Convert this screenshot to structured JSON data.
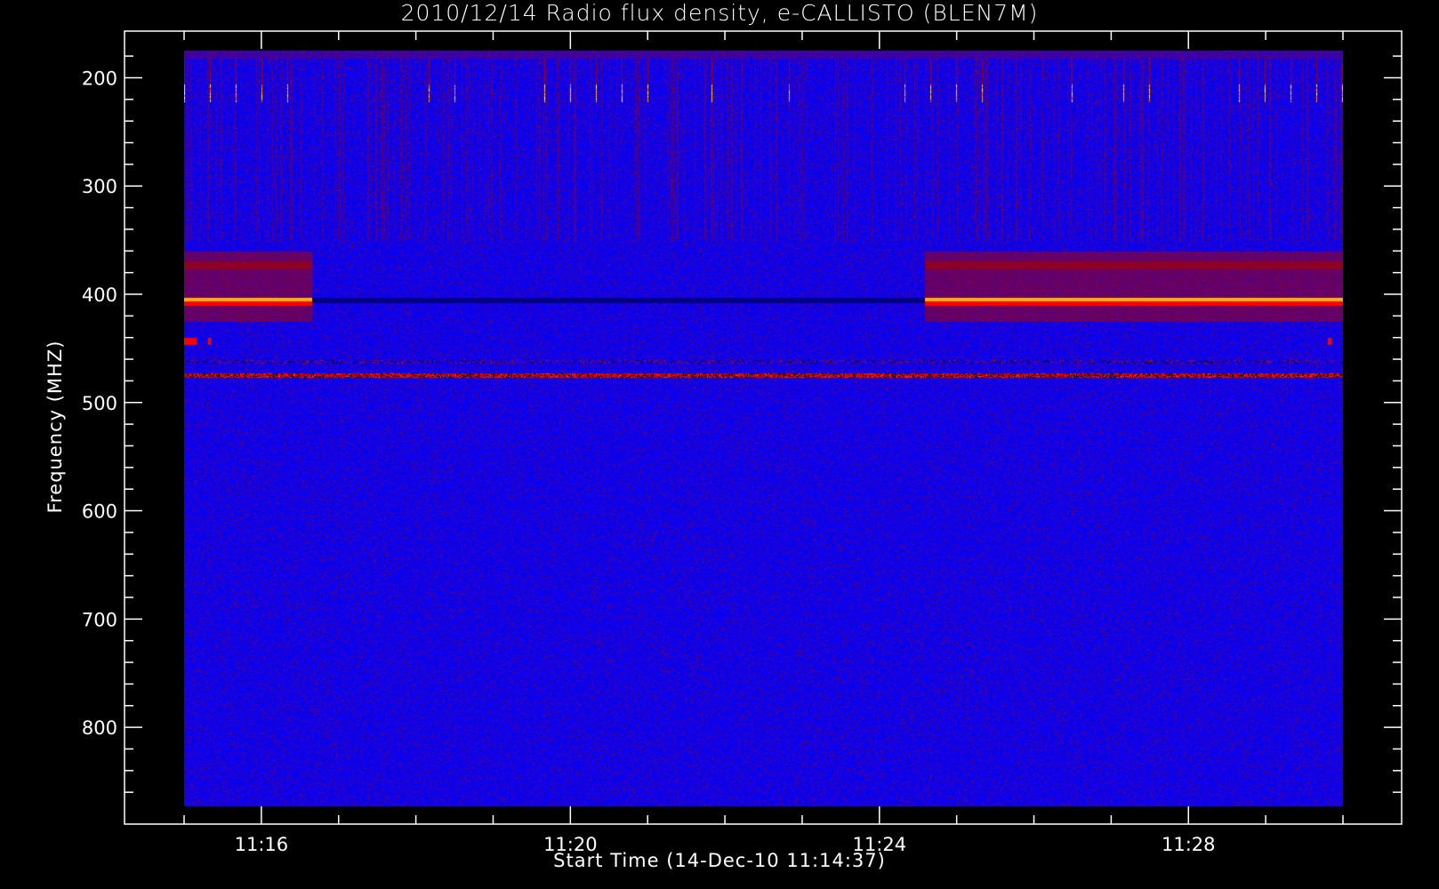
{
  "chart_data": {
    "type": "heatmap",
    "title": "2010/12/14  Radio flux density, e-CALLISTO (BLEN7M)",
    "xlabel": "Start Time (14-Dec-10 11:14:37)",
    "ylabel": "Frequency (MHZ)",
    "x_range_minutes": [
      15.0,
      30.0
    ],
    "x_ticks": [
      {
        "value": 16,
        "label": "11:16"
      },
      {
        "value": 20,
        "label": "11:20"
      },
      {
        "value": 24,
        "label": "11:24"
      },
      {
        "value": 28,
        "label": "11:28"
      }
    ],
    "x_minor_step_minutes": 1,
    "ylim": [
      175,
      873
    ],
    "y_inverted": true,
    "y_ticks": [
      200,
      300,
      400,
      500,
      600,
      700,
      800
    ],
    "y_minor_step": 20,
    "colormap": [
      "#000000",
      "#0000ff",
      "#800000",
      "#ff0000",
      "#ffa000",
      "#ffff00",
      "#ffffff"
    ],
    "features": [
      {
        "name": "bright carrier",
        "freq_mhz": 405,
        "intervals_minutes": [
          [
            15.0,
            16.65
          ],
          [
            24.58,
            30.0
          ]
        ]
      },
      {
        "name": "red band",
        "freq_mhz": 373,
        "intervals_minutes": [
          [
            15.0,
            16.65
          ],
          [
            24.58,
            30.0
          ]
        ]
      },
      {
        "name": "periodic bursts",
        "freq_mhz": 212,
        "period_minutes": 0.333
      },
      {
        "name": "continuous interference",
        "freq_mhz": 475
      },
      {
        "name": "dark line",
        "freq_mhz": 462
      }
    ]
  }
}
